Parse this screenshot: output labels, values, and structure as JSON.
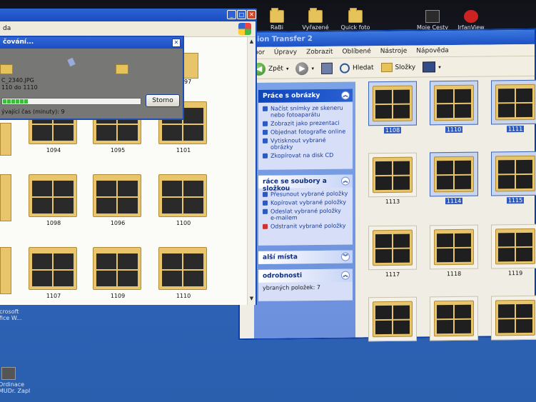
{
  "desktop": {
    "icons_top": [
      {
        "label": "RaBi",
        "name": "desktop-icon-rabi"
      },
      {
        "label": "Vyřazené",
        "name": "desktop-icon-vyrazene"
      },
      {
        "label": "Quick foto",
        "name": "desktop-icon-quick-foto"
      },
      {
        "label": "Moje Cesty",
        "name": "desktop-icon-moje-cesty"
      },
      {
        "label": "IrfanView",
        "name": "desktop-icon-irfanview"
      }
    ],
    "icons_left": [
      {
        "label": "Microsoft Office W...",
        "name": "desktop-icon-office"
      },
      {
        "label": "Ordinace MUDr. Zapl",
        "name": "desktop-icon-ordinace"
      }
    ]
  },
  "window_right": {
    "title": "ion Transfer 2",
    "menu": [
      "bor",
      "Úpravy",
      "Zobrazit",
      "Oblíbené",
      "Nástroje",
      "Nápověda"
    ],
    "toolbar": {
      "back": "Zpět",
      "search": "Hledat",
      "folders": "Složky"
    },
    "taskpane": {
      "pictures": {
        "title": "Práce s obrázky",
        "items": [
          "Načíst snímky ze skeneru nebo fotoaparátu",
          "Zobrazit jako prezentaci",
          "Objednat fotografie online",
          "Vytisknout vybrané obrázky",
          "Zkopírovat na disk CD"
        ]
      },
      "files": {
        "title": "ráce se soubory a složkou",
        "items": [
          "Přesunout vybrané položky",
          "Kopírovat vybrané položky",
          "Odeslat vybrané položky e-mailem",
          "Odstranit vybrané položky"
        ]
      },
      "places": {
        "title": "alší místa"
      },
      "details": {
        "title": "odrobnosti",
        "text": "ybraných položek: 7"
      }
    },
    "thumbs": [
      "1108",
      "1110",
      "1111",
      "1113",
      "1114",
      "1115",
      "1117",
      "1118",
      "1119",
      "",
      "",
      ""
    ]
  },
  "window_left": {
    "addr": "da",
    "thumbs_row1": [
      "1094",
      "1095",
      "1101"
    ],
    "thumbs_row2": [
      "1098",
      "1096",
      "1100"
    ],
    "thumbs_row3": [
      "1107",
      "1109",
      "1110"
    ],
    "partial_label": "97"
  },
  "dialog": {
    "title": "čování...",
    "file": "C_2340.JPG",
    "count": "110 do 1110",
    "time": "ývající čas (minuty): 9",
    "cancel": "Storno",
    "progress": 0.18
  }
}
